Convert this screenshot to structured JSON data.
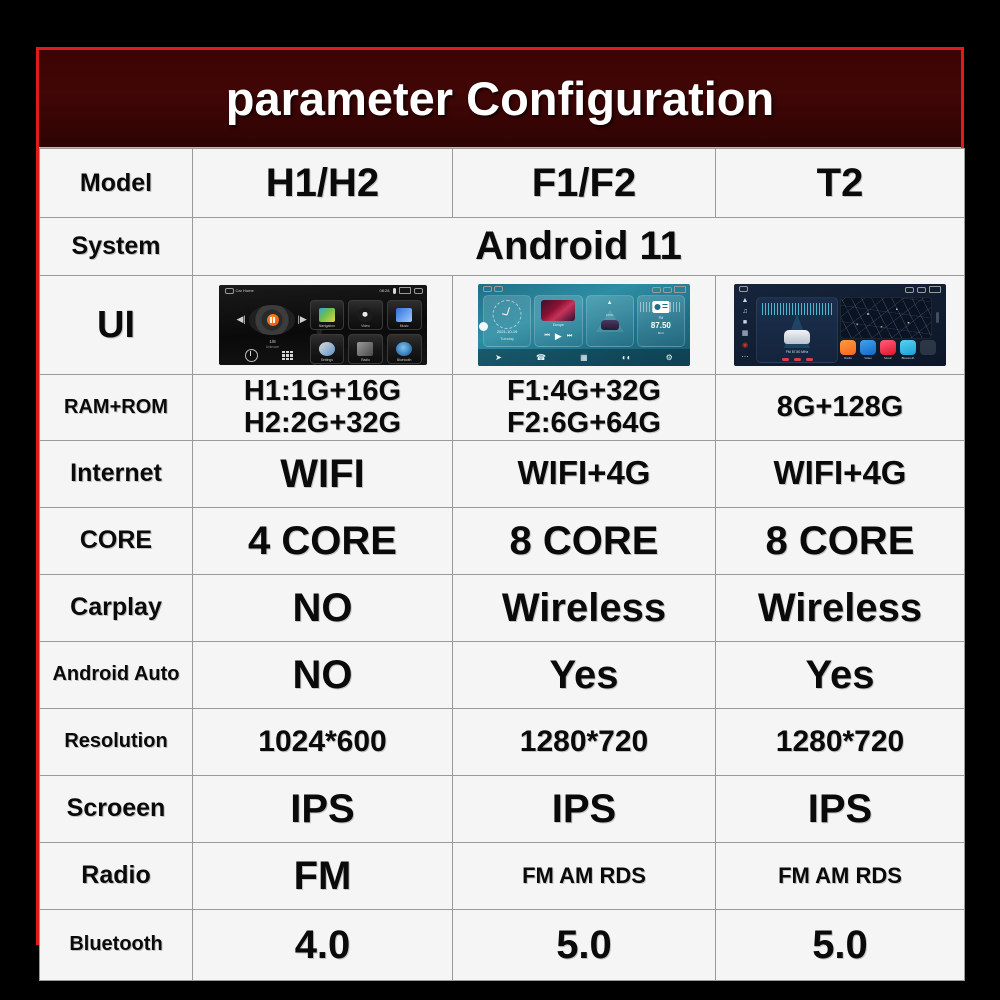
{
  "header": {
    "title": "parameter Configuration",
    "background_color": "#3d0404",
    "text_color": "#ffffff",
    "border_color": "#e01b1b"
  },
  "table": {
    "columns": [
      "Model",
      "H1/H2",
      "F1/F2",
      "T2"
    ],
    "rows": [
      {
        "label": "Model",
        "values": [
          "H1/H2",
          "F1/F2",
          "T2"
        ]
      },
      {
        "label": "System",
        "merged": true,
        "values": [
          "Android 11"
        ]
      },
      {
        "label": "UI",
        "type": "screenshots",
        "values": [
          "h1-h2-ui-screenshot",
          "f1-f2-ui-screenshot",
          "t2-ui-screenshot"
        ]
      },
      {
        "label": "RAM+ROM",
        "values": [
          "H1:1G+16G\nH2:2G+32G",
          "F1:4G+32G\nF2:6G+64G",
          "8G+128G"
        ],
        "values_lines": [
          [
            "H1:1G+16G",
            "H2:2G+32G"
          ],
          [
            "F1:4G+32G",
            "F2:6G+64G"
          ],
          [
            "8G+128G"
          ]
        ]
      },
      {
        "label": "Internet",
        "values": [
          "WIFI",
          "WIFI+4G",
          "WIFI+4G"
        ]
      },
      {
        "label": "CORE",
        "values": [
          "4 CORE",
          "8 CORE",
          "8 CORE"
        ]
      },
      {
        "label": "Carplay",
        "values": [
          "NO",
          "Wireless",
          "Wireless"
        ]
      },
      {
        "label": "Android Auto",
        "values": [
          "NO",
          "Yes",
          "Yes"
        ]
      },
      {
        "label": "Resolution",
        "values": [
          "1024*600",
          "1280*720",
          "1280*720"
        ]
      },
      {
        "label": "Scroeen",
        "values": [
          "IPS",
          "IPS",
          "IPS"
        ]
      },
      {
        "label": "Radio",
        "values": [
          "FM",
          "FM AM RDS",
          "FM AM RDS"
        ]
      },
      {
        "label": "Bluetooth",
        "values": [
          "4.0",
          "5.0",
          "5.0"
        ]
      }
    ]
  },
  "devices": {
    "h1h2": {
      "status_left": "Car Home",
      "status_time": "08:28",
      "track_number": "1/8",
      "track_sub": "Unknown",
      "tiles": [
        {
          "label": "Navigation",
          "icon": "map-icon"
        },
        {
          "label": "Video",
          "icon": "film-icon"
        },
        {
          "label": "Music",
          "icon": "music-note-icon"
        },
        {
          "label": "Settings",
          "icon": "gear-icon"
        },
        {
          "label": "Radio",
          "icon": "radio-icon"
        },
        {
          "label": "Bluetooth",
          "icon": "bluetooth-icon"
        }
      ]
    },
    "f1f2": {
      "date": "2021-10-19",
      "day": "Tuesday",
      "media_title": "Europe",
      "media_artist": "Author",
      "car_label": "100%",
      "radio_band": "FM",
      "radio_freq": "87.50",
      "radio_unit": "MHz",
      "dock_icons": [
        "navigation-icon",
        "phone-icon",
        "apps-grid-icon",
        "car-icon",
        "settings-gear-icon"
      ]
    },
    "t2": {
      "rail_icons": [
        "navigation-icon",
        "music-icon",
        "radio-icon",
        "apps-icon",
        "record-icon",
        "more-icon"
      ],
      "radio_band": "FM",
      "radio_freq": "87.50",
      "radio_unit": "MHz",
      "apps": [
        {
          "label": "Radio",
          "color": "#f4661d"
        },
        {
          "label": "Video",
          "color": "#1567c4"
        },
        {
          "label": "Music",
          "color": "#e0152f"
        },
        {
          "label": "Bluetooth",
          "color": "#1a9fd6"
        },
        {
          "label": "",
          "color": "#2a3850"
        }
      ]
    }
  }
}
